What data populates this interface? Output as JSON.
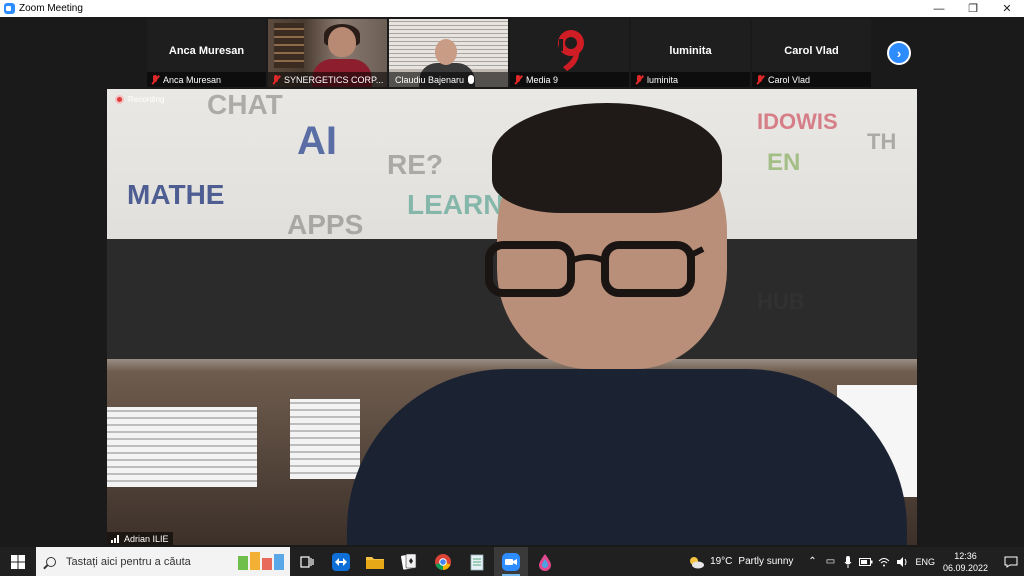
{
  "window": {
    "title": "Zoom Meeting",
    "minimize_glyph": "—",
    "restore_glyph": "❐",
    "close_glyph": "✕"
  },
  "thumbnails": [
    {
      "display_name": "Anca Muresan",
      "label": "Anca Muresan",
      "kind": "name",
      "muted": true
    },
    {
      "display_name": "",
      "label": "SYNERGETICS CORP...",
      "kind": "video",
      "muted": true
    },
    {
      "display_name": "",
      "label": "Claudiu Bajenaru",
      "kind": "video",
      "muted": false
    },
    {
      "display_name": "",
      "label": "Media 9",
      "kind": "logo",
      "muted": true
    },
    {
      "display_name": "luminita",
      "label": "luminita",
      "kind": "name",
      "muted": true
    },
    {
      "display_name": "Carol Vlad",
      "label": "Carol Vlad",
      "kind": "name",
      "muted": true
    }
  ],
  "strip_next_icon": "chevron-right-icon",
  "main_video": {
    "recording_label": "Recording",
    "speaker_name": "Adrian ILIE"
  },
  "taskbar": {
    "search_placeholder": "Tastați aici pentru a căuta",
    "weather_temp": "19°C",
    "weather_desc": "Partly sunny",
    "language": "ENG",
    "time": "12:36",
    "date": "06.09.2022"
  },
  "colors": {
    "zoom_blue": "#2d8cff",
    "mute_red": "#e02828",
    "taskbar_bg": "#202020"
  }
}
